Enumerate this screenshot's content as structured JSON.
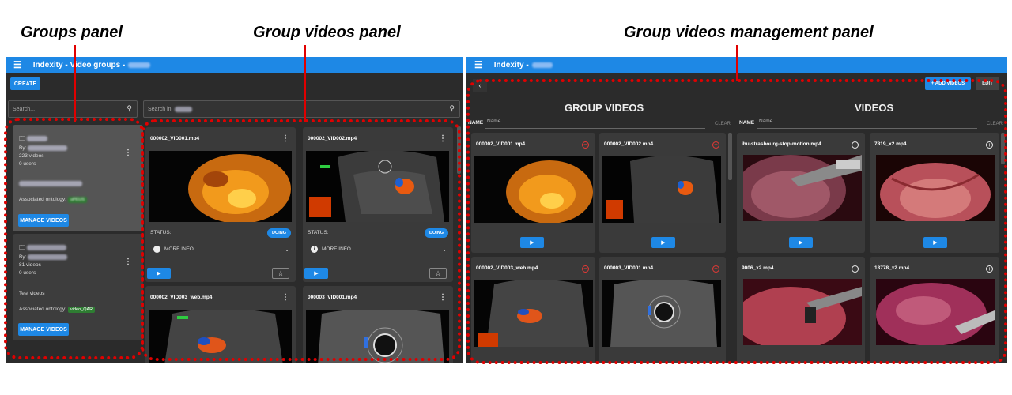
{
  "annotations": {
    "groups_panel": "Groups panel",
    "group_videos_panel": "Group videos panel",
    "management_panel": "Group videos management panel"
  },
  "left_app": {
    "title": "Indexity - Video groups -",
    "create_label": "CREATE",
    "search_placeholder": "Search...",
    "search_in_placeholder": "Search in",
    "groups": [
      {
        "name": "APEUS",
        "by": "By:",
        "videos": "223 videos",
        "users": "0 users",
        "description": "EUS videos from the pancreas",
        "ontology_label": "Associated ontology:",
        "ontology": "uPEUS",
        "manage_label": "MANAGE VIDEOS"
      },
      {
        "name": "CriticalQuery",
        "by": "By:",
        "videos": "81 videos",
        "users": "0 users",
        "description": "Test videos",
        "ontology_label": "Associated ontology:",
        "ontology": "video_QAR",
        "manage_label": "MANAGE VIDEOS"
      }
    ],
    "videos": [
      {
        "name": "000002_VID001.mp4",
        "status_label": "STATUS:",
        "status": "DOING",
        "more_info": "MORE INFO"
      },
      {
        "name": "000002_VID002.mp4",
        "status_label": "STATUS:",
        "status": "DOING",
        "more_info": "MORE INFO"
      },
      {
        "name": "000002_VID003_web.mp4"
      },
      {
        "name": "000003_VID001.mp4"
      }
    ]
  },
  "right_app": {
    "title": "Indexity -",
    "add_videos_label": "+ ADD VIDEOS",
    "edit_label": "EDIT",
    "group_videos_heading": "GROUP VIDEOS",
    "videos_heading": "VIDEOS",
    "name_label": "NAME",
    "name_placeholder": "Name...",
    "clear_label": "CLEAR",
    "group_videos": [
      {
        "name": "000002_VID001.mp4"
      },
      {
        "name": "000002_VID002.mp4"
      },
      {
        "name": "000002_VID003_web.mp4"
      },
      {
        "name": "000003_VID001.mp4"
      }
    ],
    "videos": [
      {
        "name": "ihu-strasbourg-stop-motion.mp4"
      },
      {
        "name": "7819_x2.mp4"
      },
      {
        "name": "9006_x2.mp4"
      },
      {
        "name": "13778_x2.mp4"
      }
    ]
  },
  "colors": {
    "app_bar": "#1e88e5",
    "background": "#2b2b2b",
    "annotation": "#e00000",
    "tag": "#2e7d32"
  }
}
